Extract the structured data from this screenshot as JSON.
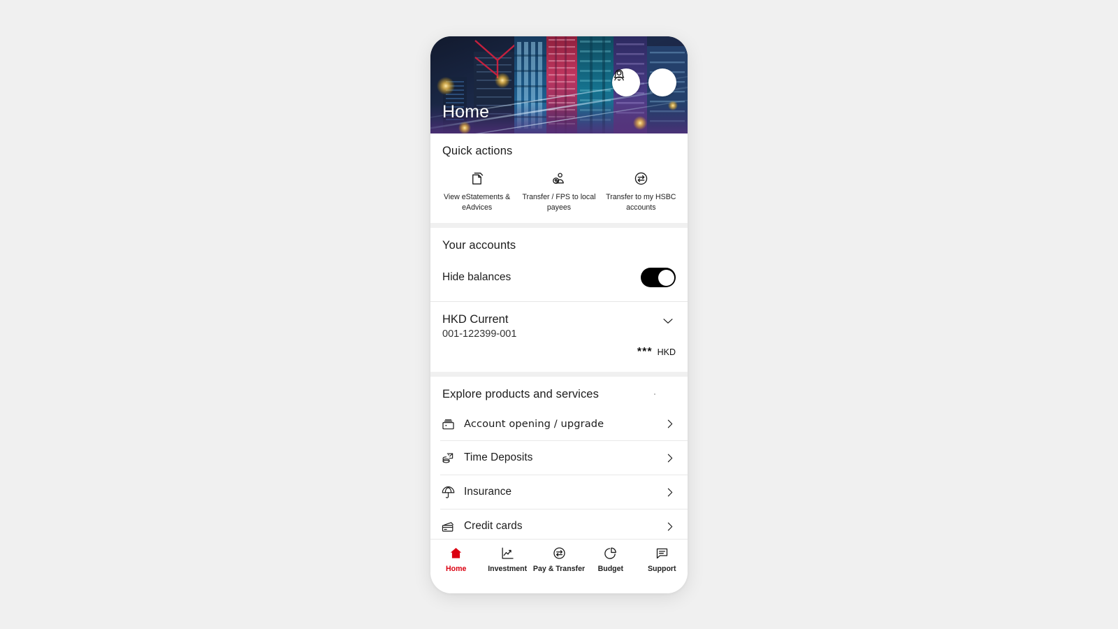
{
  "theme": {
    "brand_red": "#db0011",
    "page_bg": "#f0f0f0",
    "card_bg": "#ffffff",
    "text": "#1c1c1c"
  },
  "header": {
    "title": "Home",
    "notifications_icon": "bell-icon",
    "profile_icon": "person-icon"
  },
  "quick_actions": {
    "title": "Quick actions",
    "items": [
      {
        "icon": "document-icon",
        "label": "View eStatements & eAdvices"
      },
      {
        "icon": "person-transfer-icon",
        "label": "Transfer / FPS to local payees"
      },
      {
        "icon": "exchange-icon",
        "label": "Transfer to my HSBC accounts"
      }
    ]
  },
  "accounts": {
    "title": "Your accounts",
    "hide_balances_label": "Hide balances",
    "hide_balances_on": true,
    "list": [
      {
        "name": "HKD Current",
        "number": "001-122399-001",
        "balance_masked": "***",
        "currency": "HKD",
        "expand_icon": "chevron-down-icon"
      }
    ]
  },
  "explore": {
    "title": "Explore products and services",
    "items": [
      {
        "icon": "safe-box-icon",
        "label": "Account opening / upgrade"
      },
      {
        "icon": "coins-icon",
        "label": "Time Deposits"
      },
      {
        "icon": "umbrella-icon",
        "label": "Insurance"
      },
      {
        "icon": "credit-card-icon",
        "label": "Credit cards"
      }
    ]
  },
  "bottom_nav": {
    "items": [
      {
        "icon": "home-icon",
        "label": "Home",
        "active": true
      },
      {
        "icon": "line-chart-icon",
        "label": "Investment",
        "active": false
      },
      {
        "icon": "exchange-icon",
        "label": "Pay & Transfer",
        "active": false
      },
      {
        "icon": "pie-chart-icon",
        "label": "Budget",
        "active": false
      },
      {
        "icon": "chat-icon",
        "label": "Support",
        "active": false
      }
    ]
  }
}
